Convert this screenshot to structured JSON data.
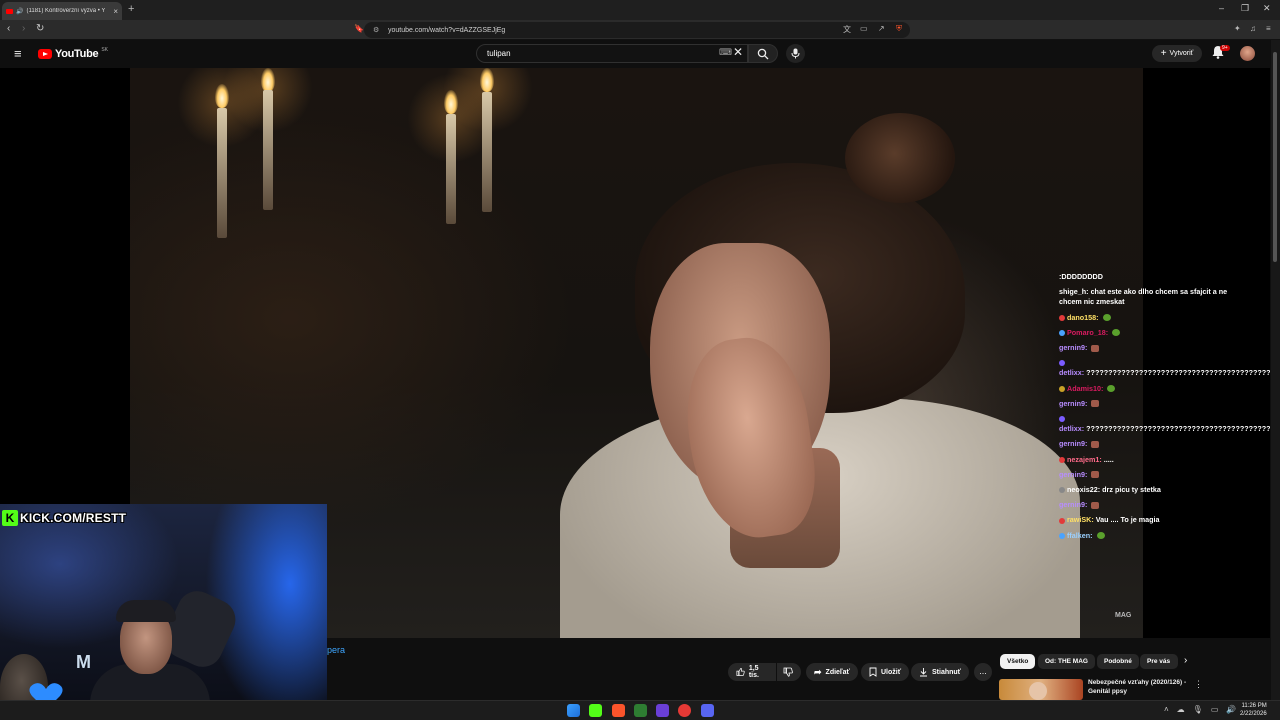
{
  "browser": {
    "tab_title": "(1181) Kontroverzní výzva • Y",
    "url": "youtube.com/watch?v=dAZZGSEJjEg"
  },
  "youtube": {
    "logo_text": "YouTube",
    "region": "SK",
    "search_value": "tulipan",
    "create_label": "Vytvoriť",
    "notifications_count": "9+"
  },
  "chat": [
    {
      "user": "",
      "user_color": "#ffffff",
      "text": ":DDDDDDDD",
      "badge": "",
      "emote": ""
    },
    {
      "user": "shige_h:",
      "user_color": "#ffffff",
      "text": "chat este ako dlho chcem sa sfajcit a nechcem nic zmeskat",
      "badge": "",
      "emote": ""
    },
    {
      "user": "dano158:",
      "user_color": "#ffe066",
      "text": "",
      "badge": "#e23a3a",
      "emote": "green"
    },
    {
      "user": "Pomaro_18:",
      "user_color": "#d81b60",
      "text": "",
      "badge": "#4aa3ff",
      "emote": "green"
    },
    {
      "user": "gernin9:",
      "user_color": "#b78cff",
      "text": "",
      "badge": "",
      "emote": "brown"
    },
    {
      "user": "detlixx:",
      "user_color": "#b78cff",
      "text": "??????????????????????????????????????????????????????????????????",
      "badge": "#7b5cff",
      "emote": ""
    },
    {
      "user": "Adamis10:",
      "user_color": "#d81b60",
      "text": "",
      "badge": "#c9a227",
      "emote": "green"
    },
    {
      "user": "gernin9:",
      "user_color": "#b78cff",
      "text": "",
      "badge": "",
      "emote": "brown"
    },
    {
      "user": "detlixx:",
      "user_color": "#b78cff",
      "text": "??????????????????????????????????????????????????????????????",
      "badge": "#7b5cff",
      "emote": ""
    },
    {
      "user": "gernin9:",
      "user_color": "#b78cff",
      "text": "",
      "badge": "",
      "emote": "brown"
    },
    {
      "user": "nezajem1:",
      "user_color": "#ff6b8a",
      "text": ".....",
      "badge": "#e23a3a",
      "emote": ""
    },
    {
      "user": "gernin9:",
      "user_color": "#b78cff",
      "text": "",
      "badge": "",
      "emote": "brown"
    },
    {
      "user": "neoxis22:",
      "user_color": "#ffffff",
      "text": "drz picu ty stetka",
      "badge": "#888888",
      "emote": ""
    },
    {
      "user": "gernin9:",
      "user_color": "#b78cff",
      "text": "",
      "badge": "",
      "emote": "brown"
    },
    {
      "user": "rawiSK:",
      "user_color": "#ffe066",
      "text": "Vau .... To je magia",
      "badge": "#e23a3a",
      "emote": ""
    },
    {
      "user": "ffalken:",
      "user_color": "#9ad0ff",
      "text": "",
      "badge": "#4aa3ff",
      "emote": "green"
    }
  ],
  "overlay": {
    "kick_text": "KICK.COM/RESTT",
    "kick_letter": "K",
    "video_watermark": "MAG"
  },
  "below_video": {
    "partial_title": "pera",
    "like_count": "1,5 tis.",
    "share_label": "Zdieľať",
    "save_label": "Uložiť",
    "download_label": "Stiahnuť",
    "more_label": "..."
  },
  "chips": [
    "Všetko",
    "Od: THE MAG",
    "Podobné",
    "Pre vás"
  ],
  "recommendation": {
    "title": "Nebezpečné vzťahy (2020/126) - Genitál ppsy"
  },
  "taskbar": {
    "time": "11:26 PM",
    "date": "2/22/2026"
  },
  "colors": {
    "youtube_red": "#ff0000",
    "kick_green": "#53fc18",
    "link_blue": "#3ea6ff"
  }
}
